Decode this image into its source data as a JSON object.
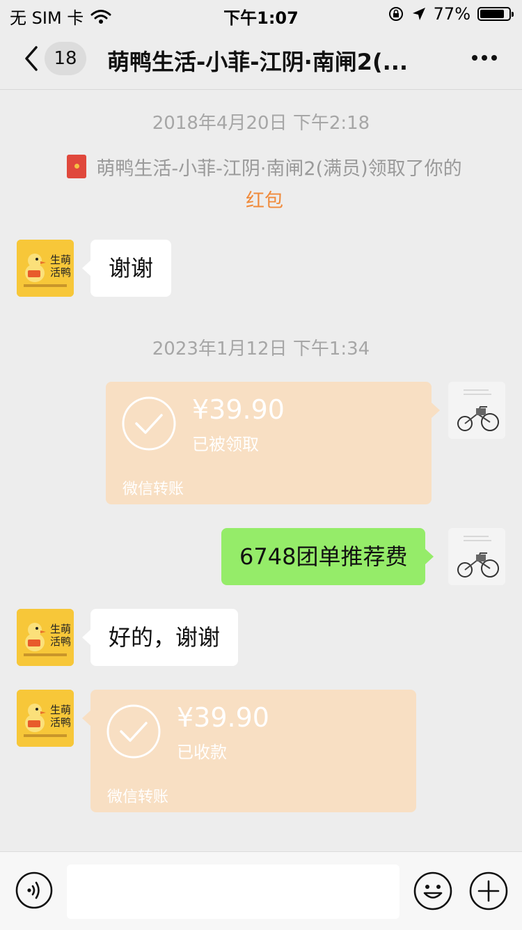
{
  "status_bar": {
    "carrier": "无 SIM 卡",
    "time": "下午1:07",
    "battery": "77%",
    "battery_level": 0.77
  },
  "nav": {
    "unread_count": "18",
    "title": "萌鸭生活-小菲-江阴·南闸2(..."
  },
  "messages": {
    "time1": "2018年4月20日 下午2:18",
    "system_text": "萌鸭生活-小菲-江阴·南闸2(满员)领取了你的",
    "system_link": "红包",
    "msg1": "谢谢",
    "time2": "2023年1月12日 下午1:34",
    "transfer1": {
      "amount": "¥39.90",
      "status": "已被领取",
      "brand": "微信转账"
    },
    "msg2": "6748团单推荐费",
    "msg3": "好的，谢谢",
    "transfer2": {
      "amount": "¥39.90",
      "status": "已收款",
      "brand": "微信转账"
    }
  },
  "input_bar": {
    "placeholder": ""
  },
  "icons": {
    "back": "chevron-left-icon",
    "more": "more-dots-icon",
    "voice": "voice-icon",
    "emoji": "emoji-icon",
    "plus": "plus-icon",
    "red_packet": "red-packet-icon",
    "check": "check-circle-icon"
  },
  "colors": {
    "background": "#ededed",
    "self_bubble": "#95ec69",
    "other_bubble": "#ffffff",
    "transfer": "#f8dfc3",
    "link": "#f08a3a"
  }
}
